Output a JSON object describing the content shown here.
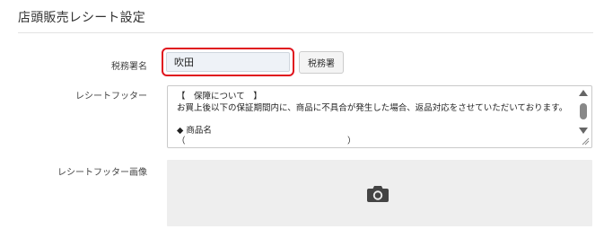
{
  "section": {
    "title": "店頭販売レシート設定"
  },
  "tax_office": {
    "label": "税務署名",
    "value": "吹田",
    "button_label": "税務署"
  },
  "receipt_footer": {
    "label": "レシートフッター",
    "text_lines": [
      "【　保障について　】",
      "お買上後以下の保証期間内に、商品に不具合が発生した場合、返品対応をさせていただいております。",
      "",
      "◆ 商品名",
      "（　　　　　　　　　　　　　　　　　　　）"
    ]
  },
  "receipt_footer_image": {
    "label": "レシートフッター画像",
    "icon": "camera-icon"
  },
  "colors": {
    "highlight_border": "#e0141e",
    "image_placeholder_bg": "#eeeeee"
  }
}
